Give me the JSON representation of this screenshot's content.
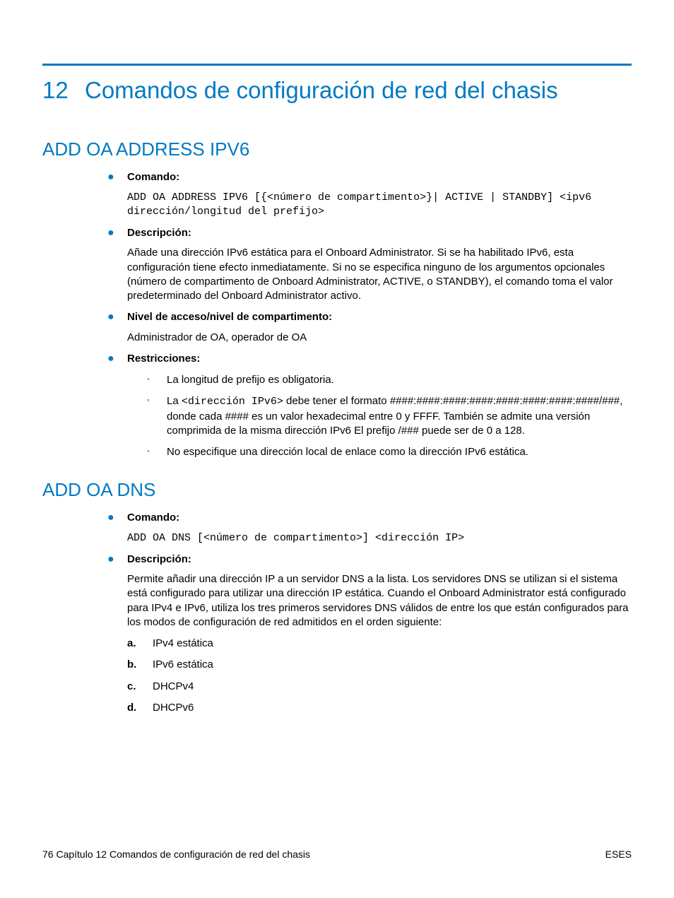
{
  "chapter": {
    "number": "12",
    "title": "Comandos de configuración de red del chasis"
  },
  "sec1": {
    "heading": "ADD OA ADDRESS IPV6",
    "comando_label": "Comando:",
    "comando_code": "ADD OA ADDRESS IPV6 [{<número de compartimento>}| ACTIVE | STANDBY] <ipv6 dirección/longitud del prefijo>",
    "descripcion_label": "Descripción:",
    "descripcion_text": "Añade una dirección IPv6 estática para el Onboard Administrator. Si se ha habilitado IPv6, esta configuración tiene efecto inmediatamente. Si no se especifica ninguno de los argumentos opcionales (número de compartimento de Onboard Administrator, ACTIVE, o STANDBY), el comando toma el valor predeterminado del Onboard Administrator activo.",
    "nivel_label": "Nivel de acceso/nivel de compartimento:",
    "nivel_text": "Administrador de OA, operador de OA",
    "restr_label": "Restricciones:",
    "r1": "La longitud de prefijo es obligatoria.",
    "r2_pre": "La ",
    "r2_code": "<dirección IPv6>",
    "r2_post": " debe tener el formato ####:####:####:####:####:####:####:####/###, donde cada #### es un valor hexadecimal entre 0 y FFFF. También se admite una versión comprimida de la misma dirección IPv6 El prefijo /### puede ser de 0 a 128.",
    "r3": "No especifique una dirección local de enlace como la dirección IPv6 estática."
  },
  "sec2": {
    "heading": "ADD OA DNS",
    "comando_label": "Comando:",
    "comando_code": "ADD OA DNS [<número de compartimento>] <dirección IP>",
    "descripcion_label": "Descripción:",
    "descripcion_text": "Permite añadir una dirección IP a un servidor DNS a la lista. Los servidores DNS se utilizan si el sistema está configurado para utilizar una dirección IP estática. Cuando el Onboard Administrator está configurado para IPv4 e IPv6, utiliza los tres primeros servidores DNS válidos de entre los que están configurados para los modos de configuración de red admitidos en el orden siguiente:",
    "ol": {
      "a": {
        "m": "a.",
        "t": "IPv4 estática"
      },
      "b": {
        "m": "b.",
        "t": "IPv6 estática"
      },
      "c": {
        "m": "c.",
        "t": "DHCPv4"
      },
      "d": {
        "m": "d.",
        "t": "DHCPv6"
      }
    }
  },
  "footer": {
    "page": "76",
    "left_sep": "   ",
    "left_text": "Capítulo 12   Comandos de configuración de red del chasis",
    "right": "ESES"
  }
}
